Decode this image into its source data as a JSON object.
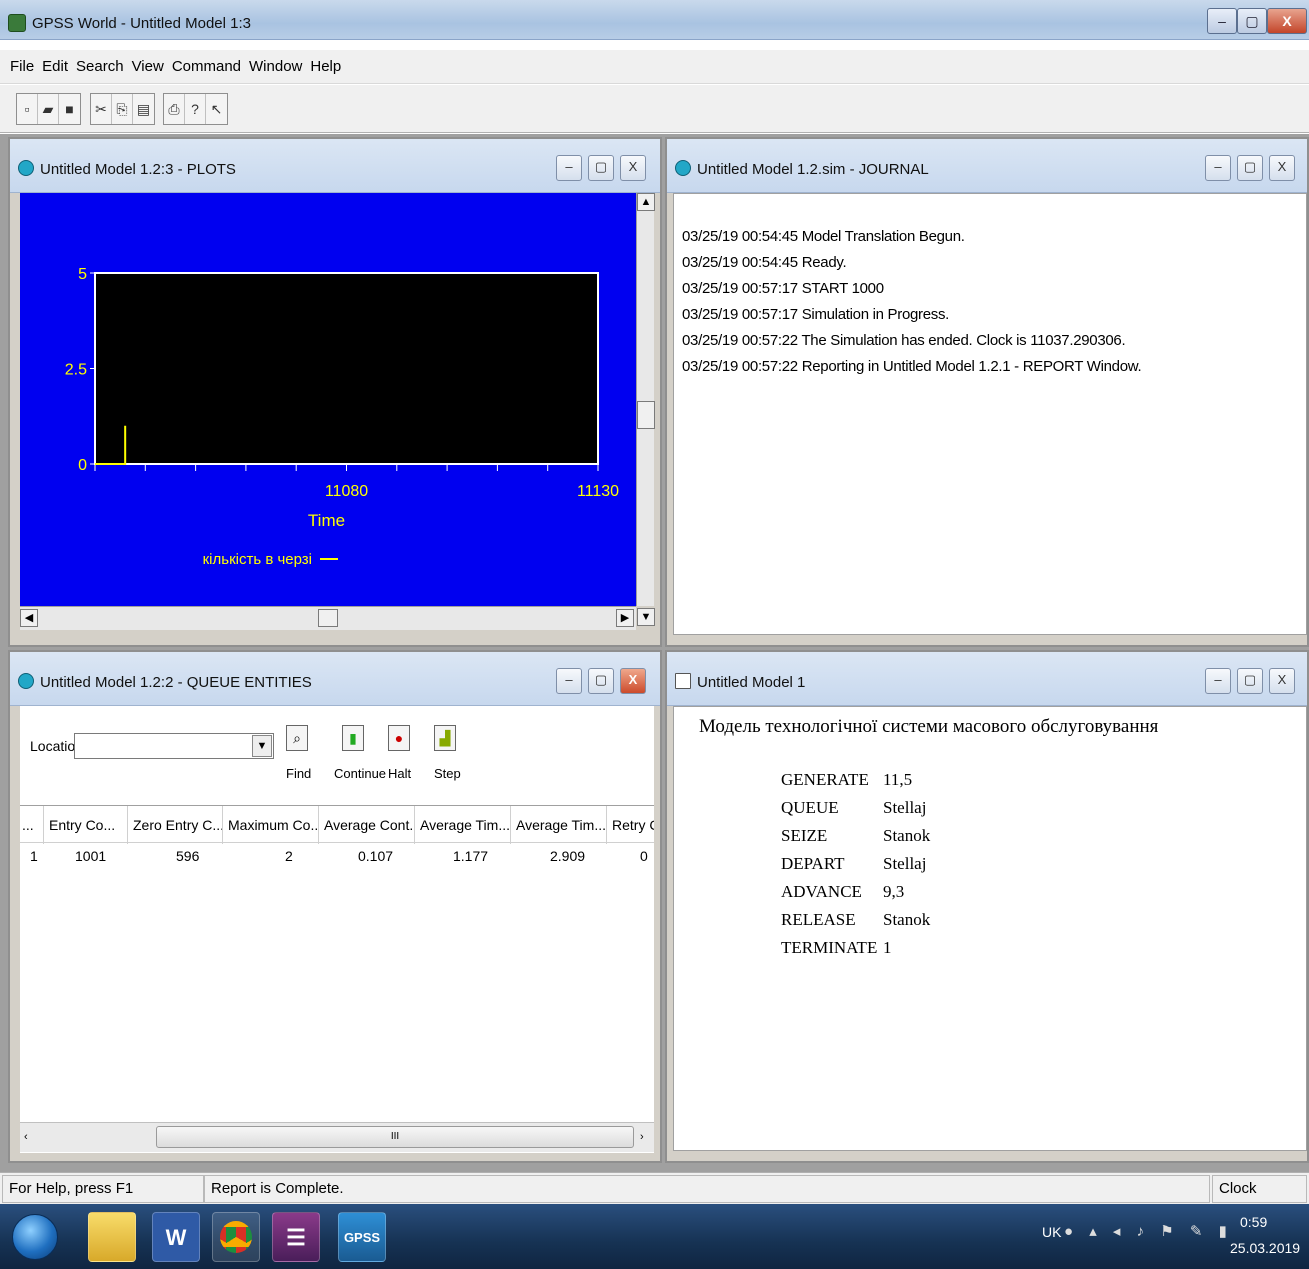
{
  "app": {
    "title": "GPSS World - Untitled Model 1:3",
    "menu": [
      "File",
      "Edit",
      "Search",
      "View",
      "Command",
      "Window",
      "Help"
    ],
    "toolbar_icons": [
      "new-icon",
      "open-icon",
      "save-icon",
      "cut-icon",
      "copy-icon",
      "paste-icon",
      "print-icon",
      "help-icon",
      "context-help-icon"
    ]
  },
  "plots_window": {
    "title": "Untitled Model 1.2:3  -  PLOTS"
  },
  "chart_data": {
    "type": "line",
    "xlabel": "Time",
    "ylabel": "",
    "xticks": [
      "11080",
      "11130"
    ],
    "yticks": [
      "5",
      "2.5",
      "0"
    ],
    "xlim": [
      11030,
      11130
    ],
    "ylim": [
      0,
      5
    ],
    "grid": false,
    "legend": "bottom-center",
    "series": [
      {
        "name": "кількість в черзі",
        "color": "#ffff00",
        "x": [
          11030,
          11036,
          11036
        ],
        "y": [
          0,
          0,
          1
        ]
      }
    ]
  },
  "journal_window": {
    "title": "Untitled Model 1.2.sim  -  JOURNAL",
    "lines": [
      "03/25/19 00:54:45  Model Translation Begun.",
      "03/25/19 00:54:45  Ready.",
      "03/25/19 00:57:17  START 1000",
      "03/25/19 00:57:17  Simulation in Progress.",
      "03/25/19 00:57:22  The Simulation has ended.  Clock is 11037.290306.",
      "03/25/19 00:57:22  Reporting in Untitled Model 1.2.1  -  REPORT Window."
    ]
  },
  "queue_window": {
    "title": "Untitled Model 1.2:2  -  QUEUE ENTITIES",
    "location_label": "Location",
    "location_value": "",
    "buttons": [
      "Find",
      "Continue",
      "Halt",
      "Step"
    ],
    "columns": [
      "...",
      "Entry Co...",
      "Zero Entry C...",
      "Maximum Co...",
      "Average Cont...",
      "Average Tim...",
      "Average Tim...",
      "Retry Ch..."
    ],
    "rows": [
      [
        "1",
        "1001",
        "596",
        "2",
        "0.107",
        "1.177",
        "2.909",
        "0"
      ]
    ],
    "scroll_marker": "III"
  },
  "model_window": {
    "title": "Untitled Model 1",
    "heading": "Модель технологічної системи масового обслуговування",
    "statements": [
      {
        "block": "GENERATE",
        "operand": "11,5"
      },
      {
        "block": "QUEUE",
        "operand": "Stellaj"
      },
      {
        "block": "SEIZE",
        "operand": "Stanok"
      },
      {
        "block": "DEPART",
        "operand": "Stellaj"
      },
      {
        "block": "ADVANCE",
        "operand": "9,3"
      },
      {
        "block": "RELEASE",
        "operand": "Stanok"
      },
      {
        "block": "TERMINATE",
        "operand": "1"
      }
    ]
  },
  "statusbar": {
    "help": "For Help, press F1",
    "message": "Report is Complete.",
    "clock_label": "Clock"
  },
  "taskbar": {
    "apps": [
      "explorer-icon",
      "word-icon",
      "chrome-icon",
      "winrar-icon",
      "gpss-icon"
    ],
    "lang": "UK",
    "time": "0:59",
    "date": "25.03.2019"
  }
}
